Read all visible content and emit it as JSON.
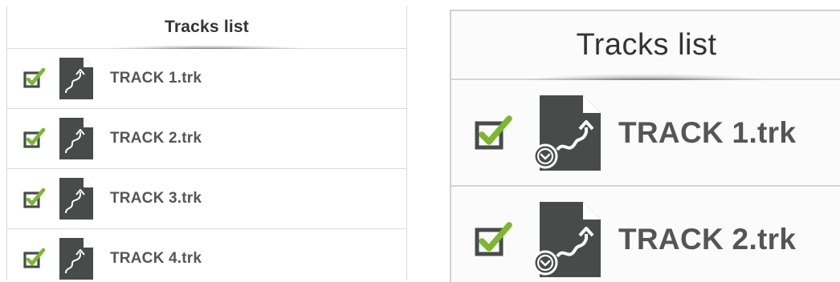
{
  "left_panel": {
    "title": "Tracks list",
    "tracks": [
      {
        "name": "TRACK 1.trk",
        "checked": true
      },
      {
        "name": "TRACK 2.trk",
        "checked": true
      },
      {
        "name": "TRACK 3.trk",
        "checked": true
      },
      {
        "name": "TRACK 4.trk",
        "checked": true
      }
    ]
  },
  "right_panel": {
    "title": "Tracks list",
    "tracks": [
      {
        "name": "TRACK 1.trk",
        "checked": true
      },
      {
        "name": "TRACK 2.trk",
        "checked": true
      }
    ]
  },
  "icons": {
    "checkbox": "checkbox-checked-icon",
    "file": "track-file-icon",
    "badge": "chevron-down-circle-icon"
  },
  "colors": {
    "check_green": "#7cb82f",
    "icon_dark": "#474c4b",
    "text": "#555555"
  }
}
